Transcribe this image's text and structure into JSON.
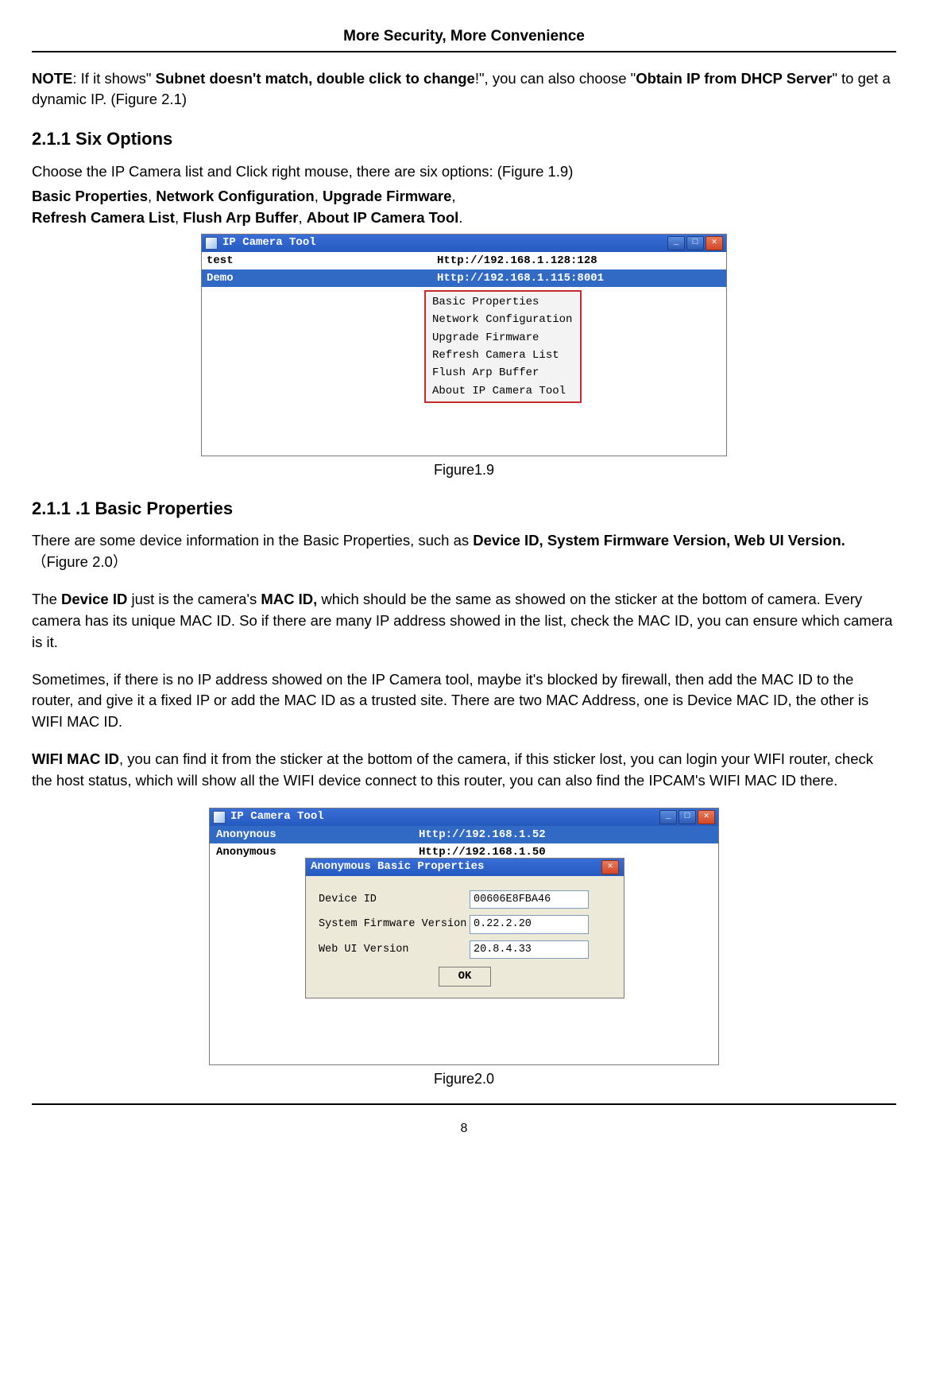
{
  "header": "More Security, More Convenience",
  "note": {
    "label": "NOTE",
    "prefix": ": If it shows\" ",
    "bold1": "Subnet doesn't match, double click to change",
    "mid": "!\", you can also choose \"",
    "bold2": "Obtain IP from DHCP Server",
    "suffix": "\" to get a dynamic IP. (Figure 2.1)"
  },
  "sec211": {
    "title": "2.1.1 Six Options",
    "line1": "Choose the IP Camera list and Click right mouse, there are six options: (Figure 1.9)",
    "opts": [
      "Basic Properties",
      "Network Configuration",
      "Upgrade Firmware",
      "Refresh Camera List",
      "Flush Arp Buffer",
      "About IP Camera Tool"
    ]
  },
  "fig19": {
    "window_title": "IP Camera Tool",
    "rows": [
      {
        "name": "test",
        "url": "Http://192.168.1.128:128"
      },
      {
        "name": "Demo",
        "url": "Http://192.168.1.115:8001"
      }
    ],
    "menu": [
      "Basic Properties",
      "Network Configuration",
      "Upgrade Firmware",
      "Refresh Camera List",
      "Flush Arp Buffer",
      "About IP Camera Tool"
    ],
    "caption": "Figure1.9"
  },
  "sec2111": {
    "title": "2.1.1 .1 Basic Properties",
    "p1_pre": "There are some device information in the Basic Properties, such as ",
    "p1_bold": "Device ID, System Firmware Version, Web UI Version.",
    "p1_post": "（Figure 2.0）",
    "p2_pre": "The ",
    "p2_b1": "Device ID",
    "p2_mid": " just is the camera's ",
    "p2_b2": "MAC ID,",
    "p2_post": " which should be the same as showed on the sticker at the bottom of camera. Every camera has its unique MAC ID. So if there are many IP address showed in the list, check the MAC ID, you can ensure which camera is it.",
    "p3": "Sometimes, if there is no IP address showed on the IP Camera tool, maybe it's blocked by firewall, then add the MAC ID to the router, and give it a fixed IP or add the MAC ID as a trusted site. There are two MAC Address, one is Device MAC ID, the other is WIFI MAC ID.",
    "p4_b": "WIFI MAC ID",
    "p4_post": ", you can find it from the sticker at the bottom of the camera, if this sticker lost, you can login your WIFI router, check the host status, which will show all the WIFI device connect to this router, you can also find the IPCAM's WIFI MAC ID there."
  },
  "fig20": {
    "window_title": "IP Camera Tool",
    "rows": [
      {
        "name": "Anonynous",
        "url": "Http://192.168.1.52"
      },
      {
        "name": "Anonymous",
        "url": "Http://192.168.1.50"
      }
    ],
    "dialog_title": "Anonymous Basic Properties",
    "fields": [
      {
        "label": "Device ID",
        "value": "00606E8FBA46"
      },
      {
        "label": "System Firmware Version",
        "value": "0.22.2.20"
      },
      {
        "label": "Web UI Version",
        "value": "20.8.4.33"
      }
    ],
    "ok": "OK",
    "caption": "Figure2.0"
  },
  "page_number": "8"
}
